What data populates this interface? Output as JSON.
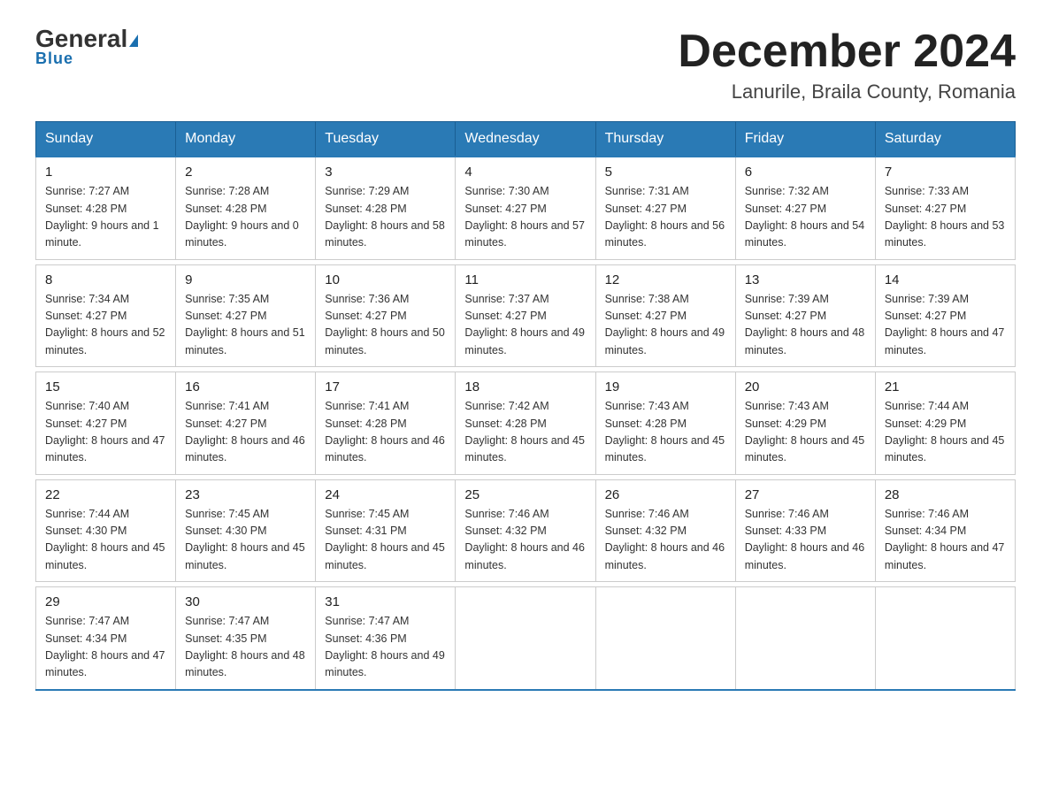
{
  "header": {
    "logo_general": "General",
    "logo_blue": "Blue",
    "main_title": "December 2024",
    "subtitle": "Lanurile, Braila County, Romania"
  },
  "days_of_week": [
    "Sunday",
    "Monday",
    "Tuesday",
    "Wednesday",
    "Thursday",
    "Friday",
    "Saturday"
  ],
  "weeks": [
    [
      {
        "day": "1",
        "sunrise": "7:27 AM",
        "sunset": "4:28 PM",
        "daylight": "9 hours and 1 minute."
      },
      {
        "day": "2",
        "sunrise": "7:28 AM",
        "sunset": "4:28 PM",
        "daylight": "9 hours and 0 minutes."
      },
      {
        "day": "3",
        "sunrise": "7:29 AM",
        "sunset": "4:28 PM",
        "daylight": "8 hours and 58 minutes."
      },
      {
        "day": "4",
        "sunrise": "7:30 AM",
        "sunset": "4:27 PM",
        "daylight": "8 hours and 57 minutes."
      },
      {
        "day": "5",
        "sunrise": "7:31 AM",
        "sunset": "4:27 PM",
        "daylight": "8 hours and 56 minutes."
      },
      {
        "day": "6",
        "sunrise": "7:32 AM",
        "sunset": "4:27 PM",
        "daylight": "8 hours and 54 minutes."
      },
      {
        "day": "7",
        "sunrise": "7:33 AM",
        "sunset": "4:27 PM",
        "daylight": "8 hours and 53 minutes."
      }
    ],
    [
      {
        "day": "8",
        "sunrise": "7:34 AM",
        "sunset": "4:27 PM",
        "daylight": "8 hours and 52 minutes."
      },
      {
        "day": "9",
        "sunrise": "7:35 AM",
        "sunset": "4:27 PM",
        "daylight": "8 hours and 51 minutes."
      },
      {
        "day": "10",
        "sunrise": "7:36 AM",
        "sunset": "4:27 PM",
        "daylight": "8 hours and 50 minutes."
      },
      {
        "day": "11",
        "sunrise": "7:37 AM",
        "sunset": "4:27 PM",
        "daylight": "8 hours and 49 minutes."
      },
      {
        "day": "12",
        "sunrise": "7:38 AM",
        "sunset": "4:27 PM",
        "daylight": "8 hours and 49 minutes."
      },
      {
        "day": "13",
        "sunrise": "7:39 AM",
        "sunset": "4:27 PM",
        "daylight": "8 hours and 48 minutes."
      },
      {
        "day": "14",
        "sunrise": "7:39 AM",
        "sunset": "4:27 PM",
        "daylight": "8 hours and 47 minutes."
      }
    ],
    [
      {
        "day": "15",
        "sunrise": "7:40 AM",
        "sunset": "4:27 PM",
        "daylight": "8 hours and 47 minutes."
      },
      {
        "day": "16",
        "sunrise": "7:41 AM",
        "sunset": "4:27 PM",
        "daylight": "8 hours and 46 minutes."
      },
      {
        "day": "17",
        "sunrise": "7:41 AM",
        "sunset": "4:28 PM",
        "daylight": "8 hours and 46 minutes."
      },
      {
        "day": "18",
        "sunrise": "7:42 AM",
        "sunset": "4:28 PM",
        "daylight": "8 hours and 45 minutes."
      },
      {
        "day": "19",
        "sunrise": "7:43 AM",
        "sunset": "4:28 PM",
        "daylight": "8 hours and 45 minutes."
      },
      {
        "day": "20",
        "sunrise": "7:43 AM",
        "sunset": "4:29 PM",
        "daylight": "8 hours and 45 minutes."
      },
      {
        "day": "21",
        "sunrise": "7:44 AM",
        "sunset": "4:29 PM",
        "daylight": "8 hours and 45 minutes."
      }
    ],
    [
      {
        "day": "22",
        "sunrise": "7:44 AM",
        "sunset": "4:30 PM",
        "daylight": "8 hours and 45 minutes."
      },
      {
        "day": "23",
        "sunrise": "7:45 AM",
        "sunset": "4:30 PM",
        "daylight": "8 hours and 45 minutes."
      },
      {
        "day": "24",
        "sunrise": "7:45 AM",
        "sunset": "4:31 PM",
        "daylight": "8 hours and 45 minutes."
      },
      {
        "day": "25",
        "sunrise": "7:46 AM",
        "sunset": "4:32 PM",
        "daylight": "8 hours and 46 minutes."
      },
      {
        "day": "26",
        "sunrise": "7:46 AM",
        "sunset": "4:32 PM",
        "daylight": "8 hours and 46 minutes."
      },
      {
        "day": "27",
        "sunrise": "7:46 AM",
        "sunset": "4:33 PM",
        "daylight": "8 hours and 46 minutes."
      },
      {
        "day": "28",
        "sunrise": "7:46 AM",
        "sunset": "4:34 PM",
        "daylight": "8 hours and 47 minutes."
      }
    ],
    [
      {
        "day": "29",
        "sunrise": "7:47 AM",
        "sunset": "4:34 PM",
        "daylight": "8 hours and 47 minutes."
      },
      {
        "day": "30",
        "sunrise": "7:47 AM",
        "sunset": "4:35 PM",
        "daylight": "8 hours and 48 minutes."
      },
      {
        "day": "31",
        "sunrise": "7:47 AM",
        "sunset": "4:36 PM",
        "daylight": "8 hours and 49 minutes."
      },
      null,
      null,
      null,
      null
    ]
  ]
}
